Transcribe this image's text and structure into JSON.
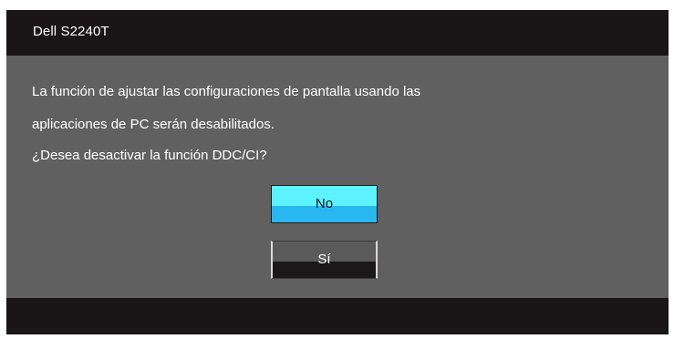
{
  "window": {
    "title": "Dell S2240T"
  },
  "dialog": {
    "message_line1": "La función de ajustar las configuraciones de pantalla usando las",
    "message_line2": "aplicaciones de PC serán desabilitados.",
    "question": "¿Desea desactivar la función DDC/CI?",
    "buttons": {
      "no_label": "No",
      "si_label": "Sí"
    },
    "selected_button": "No"
  },
  "colors": {
    "frame": "#1a1617",
    "panel": "#606060",
    "selected_top": "#5cf3ff",
    "selected_bottom": "#29b7f0",
    "unselected_top": "#5a5a5a",
    "unselected_bottom": "#1b1819",
    "text": "#ffffff"
  }
}
